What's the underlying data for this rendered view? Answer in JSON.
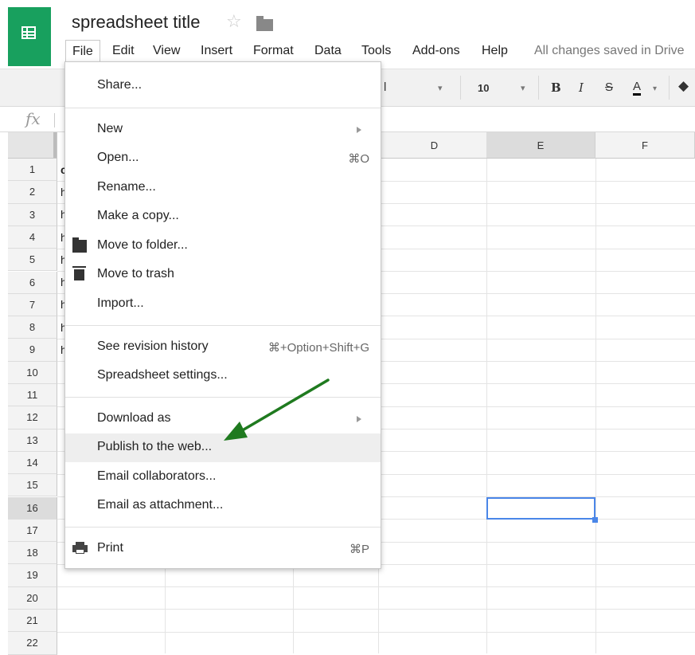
{
  "app": {
    "brand_color": "#18a05e",
    "accent_color": "#4a86e8",
    "annotation_arrow_color": "#1f7a1f"
  },
  "header": {
    "title": "spreadsheet title",
    "star_icon": "star-icon",
    "folder_icon": "folder-icon"
  },
  "menubar": {
    "items": [
      "File",
      "Edit",
      "View",
      "Insert",
      "Format",
      "Data",
      "Tools",
      "Add-ons",
      "Help"
    ],
    "active": "File",
    "status": "All changes saved in Drive"
  },
  "toolbar": {
    "font_fragment": "l",
    "font_size": "10",
    "bold": "B",
    "italic": "I",
    "strike": "S",
    "text_color": "A"
  },
  "formula_bar": {
    "icon": "fx"
  },
  "grid": {
    "columns": [
      "D",
      "E",
      "F"
    ],
    "selected_column": "E",
    "rows": [
      "1",
      "2",
      "3",
      "4",
      "5",
      "6",
      "7",
      "8",
      "9",
      "10",
      "11",
      "12",
      "13",
      "14",
      "15",
      "16",
      "17",
      "18",
      "19",
      "20",
      "21",
      "22"
    ],
    "selected_row": "16",
    "col_a_fragments": [
      "c",
      "h",
      "h",
      "h",
      "h",
      "h",
      "h",
      "h",
      "h"
    ]
  },
  "file_menu": {
    "share": "Share...",
    "new": "New",
    "open": "Open...",
    "open_shortcut": "⌘O",
    "rename": "Rename...",
    "make_copy": "Make a copy...",
    "move_to_folder": "Move to folder...",
    "move_to_trash": "Move to trash",
    "import": "Import...",
    "revision_history": "See revision history",
    "revision_shortcut": "⌘+Option+Shift+G",
    "spreadsheet_settings": "Spreadsheet settings...",
    "download_as": "Download as",
    "publish": "Publish to the web...",
    "email_collaborators": "Email collaborators...",
    "email_attachment": "Email as attachment...",
    "print": "Print",
    "print_shortcut": "⌘P"
  }
}
